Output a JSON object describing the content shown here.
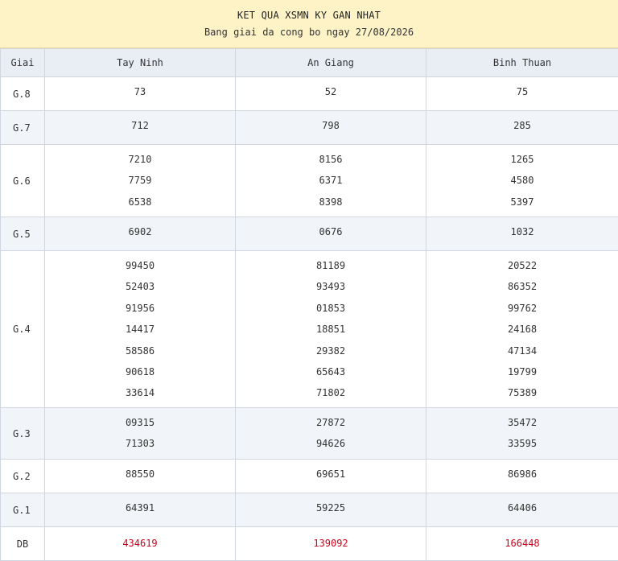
{
  "header": {
    "title": "KET QUA XSMN KY GAN NHAT",
    "subtitle": "Bang giai da cong bo ngay 27/08/2026"
  },
  "table": {
    "columns": [
      "Giai",
      "Tay Ninh",
      "An Giang",
      "Binh Thuan"
    ],
    "rows": [
      {
        "label": "G.8",
        "values": [
          [
            "73"
          ],
          [
            "52"
          ],
          [
            "75"
          ]
        ]
      },
      {
        "label": "G.7",
        "values": [
          [
            "712"
          ],
          [
            "798"
          ],
          [
            "285"
          ]
        ]
      },
      {
        "label": "G.6",
        "values": [
          [
            "7210",
            "7759",
            "6538"
          ],
          [
            "8156",
            "6371",
            "8398"
          ],
          [
            "1265",
            "4580",
            "5397"
          ]
        ]
      },
      {
        "label": "G.5",
        "values": [
          [
            "6902"
          ],
          [
            "0676"
          ],
          [
            "1032"
          ]
        ]
      },
      {
        "label": "G.4",
        "values": [
          [
            "99450",
            "52403",
            "91956",
            "14417",
            "58586",
            "90618",
            "33614"
          ],
          [
            "81189",
            "93493",
            "01853",
            "18851",
            "29382",
            "65643",
            "71802"
          ],
          [
            "20522",
            "86352",
            "99762",
            "24168",
            "47134",
            "19799",
            "75389"
          ]
        ]
      },
      {
        "label": "G.3",
        "values": [
          [
            "09315",
            "71303"
          ],
          [
            "27872",
            "94626"
          ],
          [
            "35472",
            "33595"
          ]
        ]
      },
      {
        "label": "G.2",
        "values": [
          [
            "88550"
          ],
          [
            "69651"
          ],
          [
            "86986"
          ]
        ]
      },
      {
        "label": "G.1",
        "values": [
          [
            "64391"
          ],
          [
            "59225"
          ],
          [
            "64406"
          ]
        ]
      },
      {
        "label": "DB",
        "values": [
          [
            "434619"
          ],
          [
            "139092"
          ],
          [
            "166448"
          ]
        ]
      }
    ]
  },
  "colors": {
    "header_bg": "#fdf3c7",
    "alt_row_bg": "#f1f4f8",
    "special_prize": "#d0021b"
  }
}
